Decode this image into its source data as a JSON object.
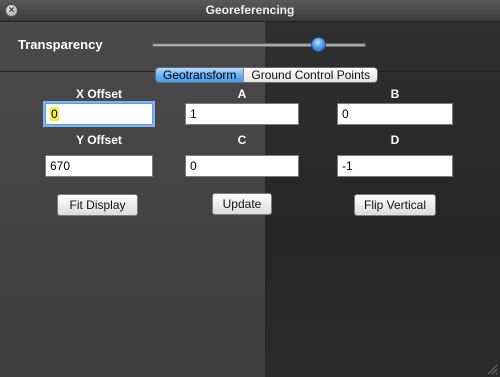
{
  "window": {
    "title": "Georeferencing",
    "close_glyph": "×"
  },
  "transparency": {
    "label": "Transparency",
    "value_fraction": 0.78
  },
  "tabs": [
    {
      "label": "Geotransform",
      "active": true
    },
    {
      "label": "Ground Control Points",
      "active": false
    }
  ],
  "fields": {
    "x_offset": {
      "label": "X Offset",
      "value": "0"
    },
    "a": {
      "label": "A",
      "value": "1"
    },
    "b": {
      "label": "B",
      "value": "0"
    },
    "y_offset": {
      "label": "Y Offset",
      "value": "670"
    },
    "c": {
      "label": "C",
      "value": "0"
    },
    "d": {
      "label": "D",
      "value": "-1"
    }
  },
  "buttons": {
    "fit_display": "Fit Display",
    "update": "Update",
    "flip_vertical": "Flip Vertical"
  },
  "colors": {
    "accent": "#4a9af0",
    "selection_highlight": "#f3f04a"
  }
}
